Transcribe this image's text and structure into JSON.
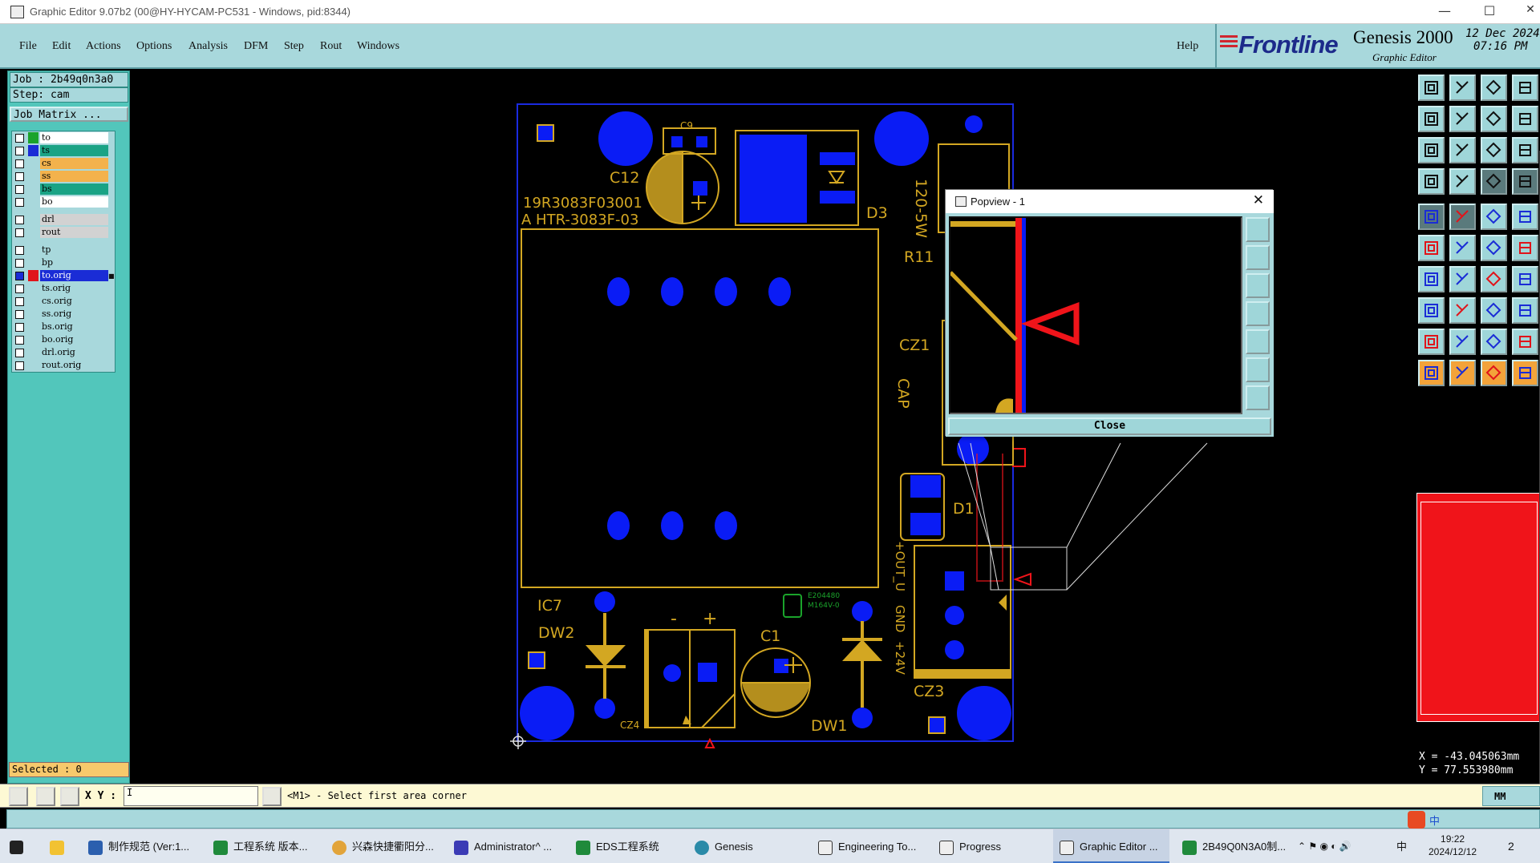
{
  "window": {
    "title": "Graphic Editor 9.07b2 (00@HY-HYCAM-PC531 - Windows, pid:8344)",
    "minimize": "—",
    "maximize": "☐",
    "close": "✕"
  },
  "menu": {
    "items": [
      "File",
      "Edit",
      "Actions",
      "Options",
      "Analysis",
      "DFM",
      "Step",
      "Rout",
      "Windows"
    ],
    "help": "Help"
  },
  "brand": {
    "logo": "Frontline",
    "product": "Genesis 2000",
    "subtitle": "Graphic Editor",
    "date": "12 Dec 2024",
    "time": "07:16 PM"
  },
  "job": {
    "job_label": "Job : 2b49q0n3a0",
    "step_label": "Step: cam",
    "matrix_button": "Job Matrix ..."
  },
  "layers": [
    {
      "name": "to",
      "color": "#1aa32b",
      "bg": "#ffffff"
    },
    {
      "name": "ts",
      "color": "#1a2cd6",
      "bg": "#1aa385"
    },
    {
      "name": "cs",
      "color": "#a8d8dc",
      "bg": "#f3b24c"
    },
    {
      "name": "ss",
      "color": "#a8d8dc",
      "bg": "#f3b24c"
    },
    {
      "name": "bs",
      "color": "#a8d8dc",
      "bg": "#1aa385"
    },
    {
      "name": "bo",
      "color": "#a8d8dc",
      "bg": "#ffffff"
    },
    {
      "name": "drl",
      "color": "#a8d8dc",
      "bg": "#d2d2d2",
      "gap": true
    },
    {
      "name": "rout",
      "color": "#a8d8dc",
      "bg": "#d2d2d2"
    },
    {
      "name": "tp",
      "color": "#a8d8dc",
      "bg": "#a8d8dc",
      "gap": true
    },
    {
      "name": "bp",
      "color": "#a8d8dc",
      "bg": "#a8d8dc"
    },
    {
      "name": "to.orig",
      "color": "#e0141a",
      "bg": "#1a2cd6",
      "light": true,
      "dot": true
    },
    {
      "name": "ts.orig",
      "color": "#a8d8dc",
      "bg": "#a8d8dc"
    },
    {
      "name": "cs.orig",
      "color": "#a8d8dc",
      "bg": "#a8d8dc"
    },
    {
      "name": "ss.orig",
      "color": "#a8d8dc",
      "bg": "#a8d8dc"
    },
    {
      "name": "bs.orig",
      "color": "#a8d8dc",
      "bg": "#a8d8dc"
    },
    {
      "name": "bo.orig",
      "color": "#a8d8dc",
      "bg": "#a8d8dc"
    },
    {
      "name": "drl.orig",
      "color": "#a8d8dc",
      "bg": "#a8d8dc"
    },
    {
      "name": "rout.orig",
      "color": "#a8d8dc",
      "bg": "#a8d8dc"
    }
  ],
  "selected": "Selected : 0",
  "board": {
    "labels": [
      "C9",
      "C12",
      "19R3083F03001",
      "A HTR-3083F-03",
      "D3",
      "120-5W",
      "R11",
      "CZ1",
      "CAP",
      "D1",
      "+OUT_U",
      "GND",
      "+24V",
      "IC7",
      "DW2",
      "C1",
      "CZ4",
      "DW1",
      "CZ3",
      "E204480",
      "M164V-0"
    ],
    "minus": "-",
    "plus": "+"
  },
  "popup": {
    "title": "Popview - 1",
    "close_button": "Close",
    "close_icon": "✕"
  },
  "coords": {
    "x": "X = -43.045063mm",
    "y": "Y = 77.553980mm"
  },
  "statusbar": {
    "xy_label": "X Y :",
    "prompt": "<M1> - Select first area corner",
    "units": "MM",
    "cursor_char": "I"
  },
  "taskbar": {
    "items": [
      "制作规范 (Ver:1...",
      "工程系统  版本...",
      "兴森快捷衢阳分...",
      "Administrator^ ...",
      "EDS工程系统",
      "Genesis",
      "Engineering To...",
      "Progress",
      "Graphic Editor ...",
      "2B49Q0N3A0制..."
    ],
    "time": "19:22",
    "date": "2024/12/12",
    "ime": "中",
    "notif": "2"
  },
  "colors": {
    "teal": "#a8d8dc",
    "panel": "#52c6bb",
    "gold": "#d3a722",
    "pad": "#0a1cf5",
    "board_edge": "#1a2ae0",
    "highlight": "#f0141a"
  }
}
